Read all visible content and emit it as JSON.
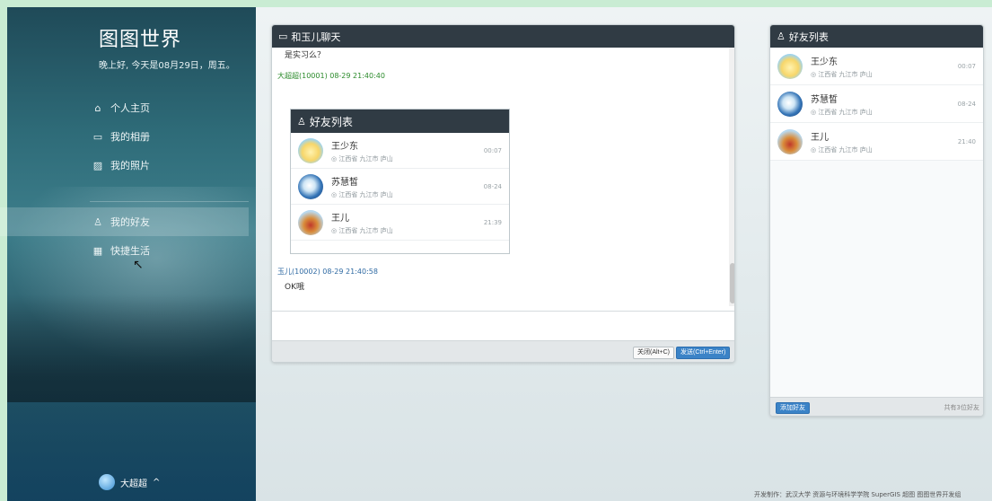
{
  "sidebar": {
    "app_title": "图图世界",
    "greeting": "晚上好, 今天是08月29日，周五。",
    "items": [
      {
        "icon": "home-icon",
        "glyph": "⌂",
        "label": "个人主页"
      },
      {
        "icon": "folder-icon",
        "glyph": "▭",
        "label": "我的相册"
      },
      {
        "icon": "image-icon",
        "glyph": "▨",
        "label": "我的照片"
      },
      {
        "icon": "user-icon",
        "glyph": "♙",
        "label": "我的好友",
        "active": true
      },
      {
        "icon": "grid-icon",
        "glyph": "▦",
        "label": "快捷生活"
      }
    ],
    "user": {
      "name": "大超超",
      "caret": "^"
    }
  },
  "chat": {
    "title": "和玉儿聊天",
    "title_icon": "chat-icon",
    "messages": [
      {
        "text": "是实习么？"
      },
      {
        "meta": "大超超(10001) 08-29 21:40:40"
      },
      {
        "meta": "玉儿(10002) 08-29 21:40:58",
        "text": "OK哦"
      }
    ],
    "embedded": {
      "title": "好友列表",
      "friends": [
        {
          "name": "王少东",
          "loc": "◎ 江西省 九江市 庐山",
          "time": "00:07"
        },
        {
          "name": "苏慧皙",
          "loc": "◎ 江西省 九江市 庐山",
          "time": "08-24"
        },
        {
          "name": "王儿",
          "loc": "◎ 江西省 九江市 庐山",
          "time": "21:39"
        }
      ]
    },
    "close_label": "关闭(Alt+C)",
    "send_label": "发送(Ctrl+Enter)"
  },
  "friends_panel": {
    "title": "好友列表",
    "friends": [
      {
        "name": "王少东",
        "loc": "◎ 江西省 九江市 庐山",
        "time": "00:07"
      },
      {
        "name": "苏慧皙",
        "loc": "◎ 江西省 九江市 庐山",
        "time": "08-24"
      },
      {
        "name": "王儿",
        "loc": "◎ 江西省 九江市 庐山",
        "time": "21:40"
      }
    ],
    "add_label": "添加好友",
    "count_text": "共有3位好友"
  },
  "footer": {
    "copyright": "开发制作：武汉大学 资源与环境科学学院 SuperGIS 超图 图图世界开发组"
  }
}
